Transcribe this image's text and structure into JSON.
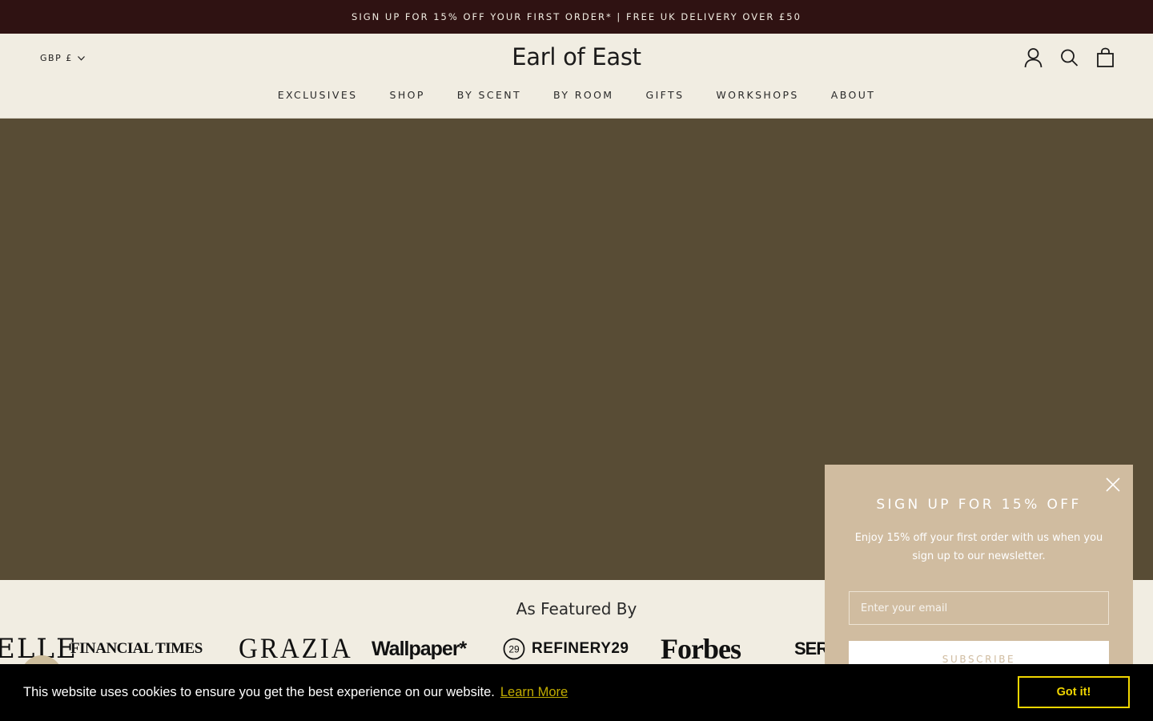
{
  "announcement": "SIGN UP FOR 15% OFF YOUR FIRST ORDER* | FREE UK DELIVERY OVER £50",
  "header": {
    "currency": "GBP £",
    "logo": "Earl of East",
    "nav": [
      "EXCLUSIVES",
      "SHOP",
      "BY SCENT",
      "BY ROOM",
      "GIFTS",
      "WORKSHOPS",
      "ABOUT"
    ],
    "icons": [
      "account-icon",
      "search-icon",
      "cart-icon"
    ]
  },
  "colors": {
    "announcement_bg": "#2f1212",
    "page_bg": "#f1ede2",
    "hero_bg": "#584c35",
    "popup_bg": "#d0bca0",
    "cookie_bg": "#000000",
    "cookie_accent": "#f1d600"
  },
  "featured": {
    "title": "As Featured By",
    "brands": [
      "ELLE",
      "FINANCIAL TIMES",
      "GRAZIA",
      "Wallpaper*",
      "REFINERY29",
      "Forbes",
      "SER"
    ]
  },
  "popup": {
    "title": "SIGN UP FOR 15% OFF",
    "text": "Enjoy 15% off your first order with us when you sign up to our newsletter.",
    "email_placeholder": "Enter your email",
    "button": "SUBSCRIBE"
  },
  "cookie": {
    "message": "This website uses cookies to ensure you get the best experience on our website.",
    "link": "Learn More",
    "button": "Got it!"
  }
}
